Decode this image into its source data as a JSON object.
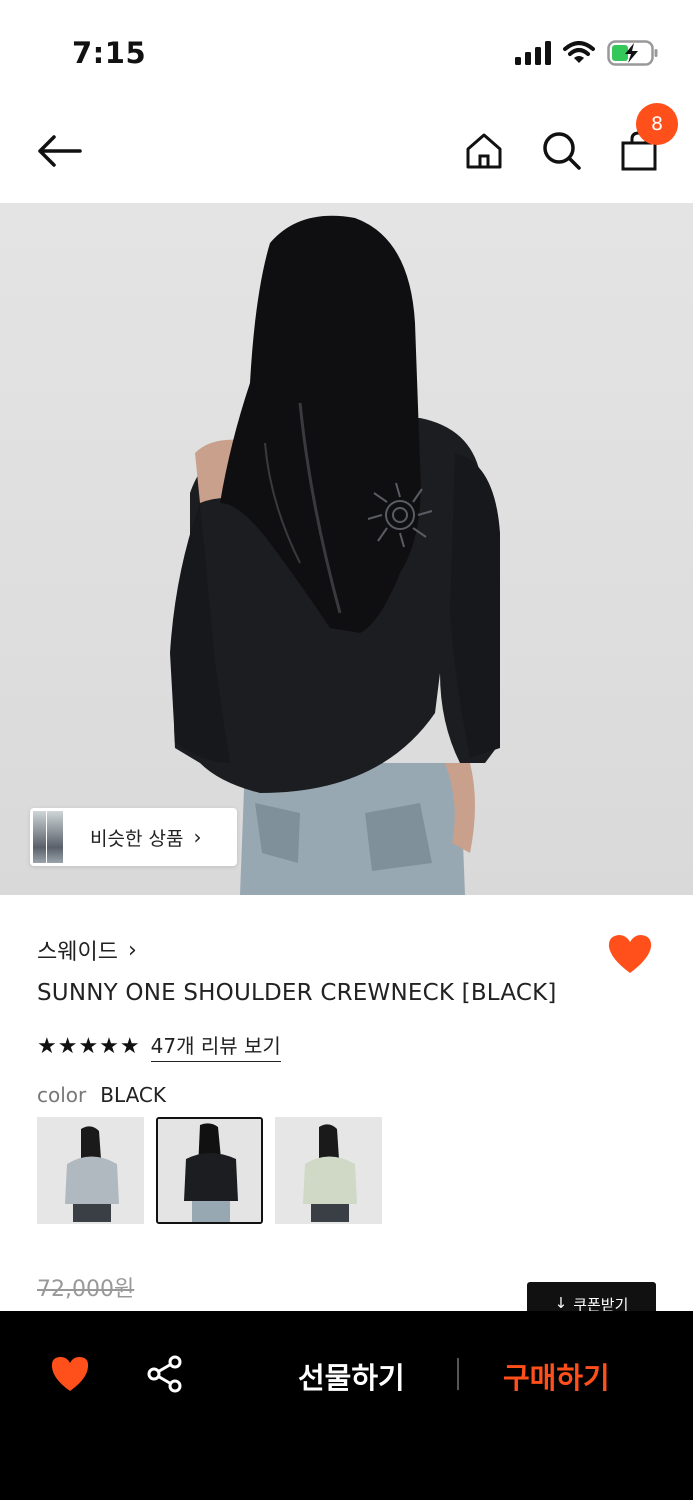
{
  "status_bar": {
    "time": "7:15"
  },
  "header": {
    "cart_count": "8"
  },
  "hero": {
    "similar_label": "비슷한 상품"
  },
  "product": {
    "brand": "스웨이드",
    "title": "SUNNY ONE SHOULDER CREWNECK [BLACK]",
    "rating": 5,
    "stars": "★★★★★",
    "review_link": "47개 리뷰 보기",
    "color_key": "color",
    "color_value": "BLACK",
    "color_options": [
      "grey",
      "black",
      "mint"
    ],
    "original_price": "72,000원",
    "coupon_label": "쿠폰받기"
  },
  "bottom_bar": {
    "gift_label": "선물하기",
    "buy_label": "구매하기"
  },
  "colors": {
    "accent": "#ff4f1a",
    "bar_bg": "#000000"
  }
}
